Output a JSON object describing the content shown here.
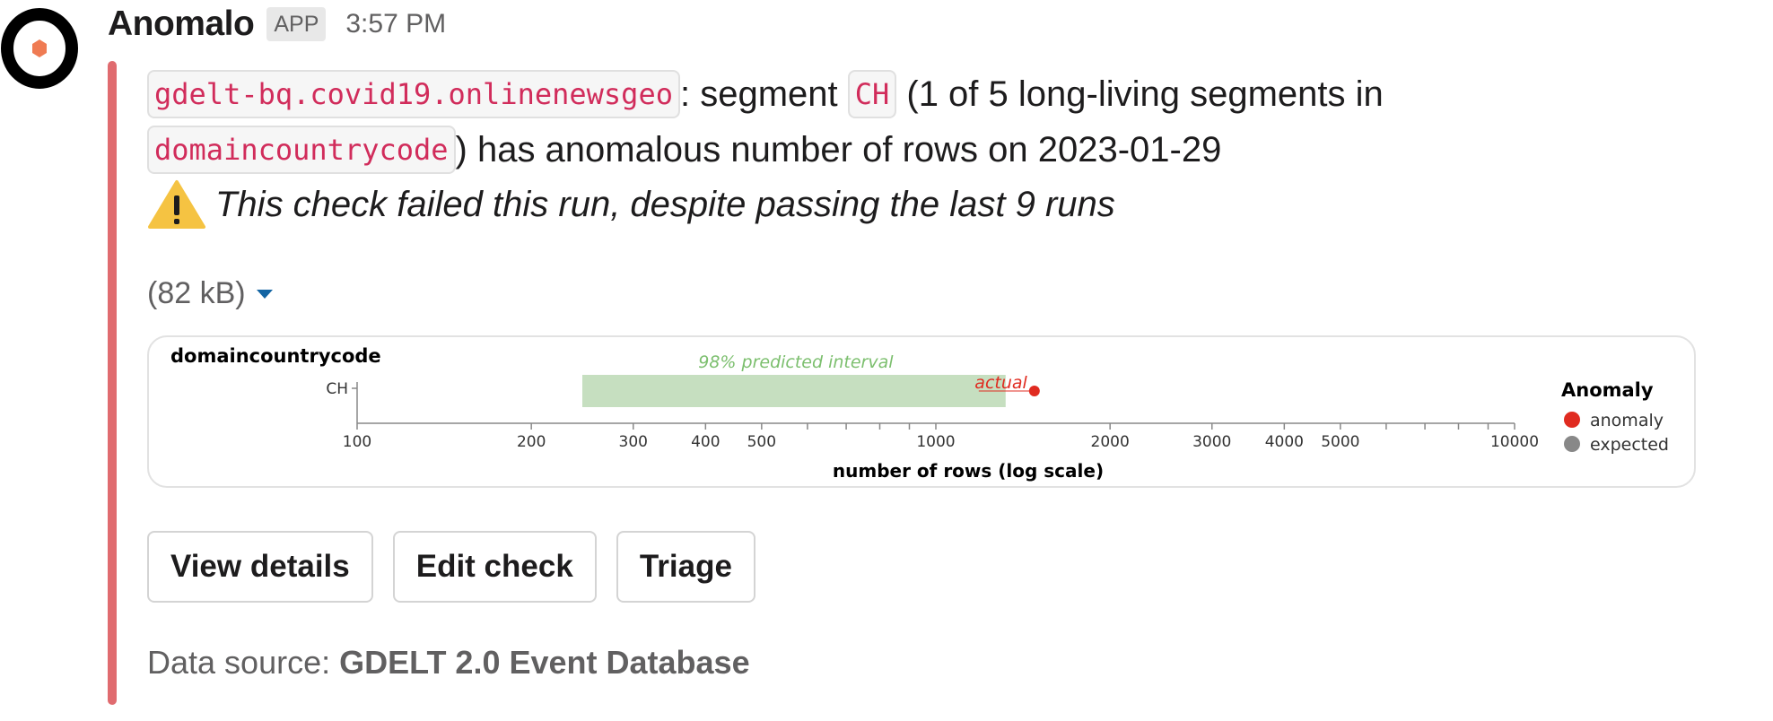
{
  "header": {
    "app_name": "Anomalo",
    "badge": "APP",
    "timestamp": "3:57 PM"
  },
  "message": {
    "table_name": "gdelt-bq.covid19.onlinenewsgeo",
    "text_segment": ": segment ",
    "segment": "CH",
    "text_count": " (1 of 5 long-living segments in",
    "column": "domaincountrycode",
    "text_anomaly": ") has anomalous number of rows on 2023-01-29",
    "warning": "This check failed this run, despite passing the last 9 runs",
    "warning_icon": "warning-triangle-icon"
  },
  "attachment": {
    "file_size": "(82 kB)"
  },
  "chart_data": {
    "type": "scatter",
    "title": "domaincountrycode",
    "xlabel": "number of rows (log scale)",
    "xscale": "log",
    "xlim": [
      100,
      10000
    ],
    "categories": [
      "CH"
    ],
    "tick_labels": [
      "100",
      "200",
      "300",
      "400",
      "500",
      "1000",
      "2000",
      "3000",
      "4000",
      "5000",
      "10000"
    ],
    "tick_values": [
      100,
      200,
      300,
      400,
      500,
      1000,
      2000,
      3000,
      4000,
      5000,
      10000
    ],
    "minor_tick_values": [
      600,
      700,
      800,
      900,
      6000,
      7000,
      8000,
      9000
    ],
    "interval": {
      "label": "98% predicted interval",
      "low": 245,
      "high": 1320,
      "color": "#c6dfc0"
    },
    "actual": {
      "label": "actual",
      "value": 1480,
      "color": "#e02b20"
    },
    "legend": {
      "title": "Anomaly",
      "position": "right",
      "items": [
        {
          "label": "anomaly",
          "color": "#e02b20"
        },
        {
          "label": "expected",
          "color": "#888888"
        }
      ]
    }
  },
  "buttons": {
    "view_details": "View details",
    "edit_check": "Edit check",
    "triage": "Triage"
  },
  "footer": {
    "source_label": "Data source: ",
    "source_name": "GDELT 2.0 Event Database"
  },
  "colors": {
    "accent_bar": "#e06b6f",
    "code_text": "#d12c5b",
    "link_blue": "#1264a3"
  }
}
